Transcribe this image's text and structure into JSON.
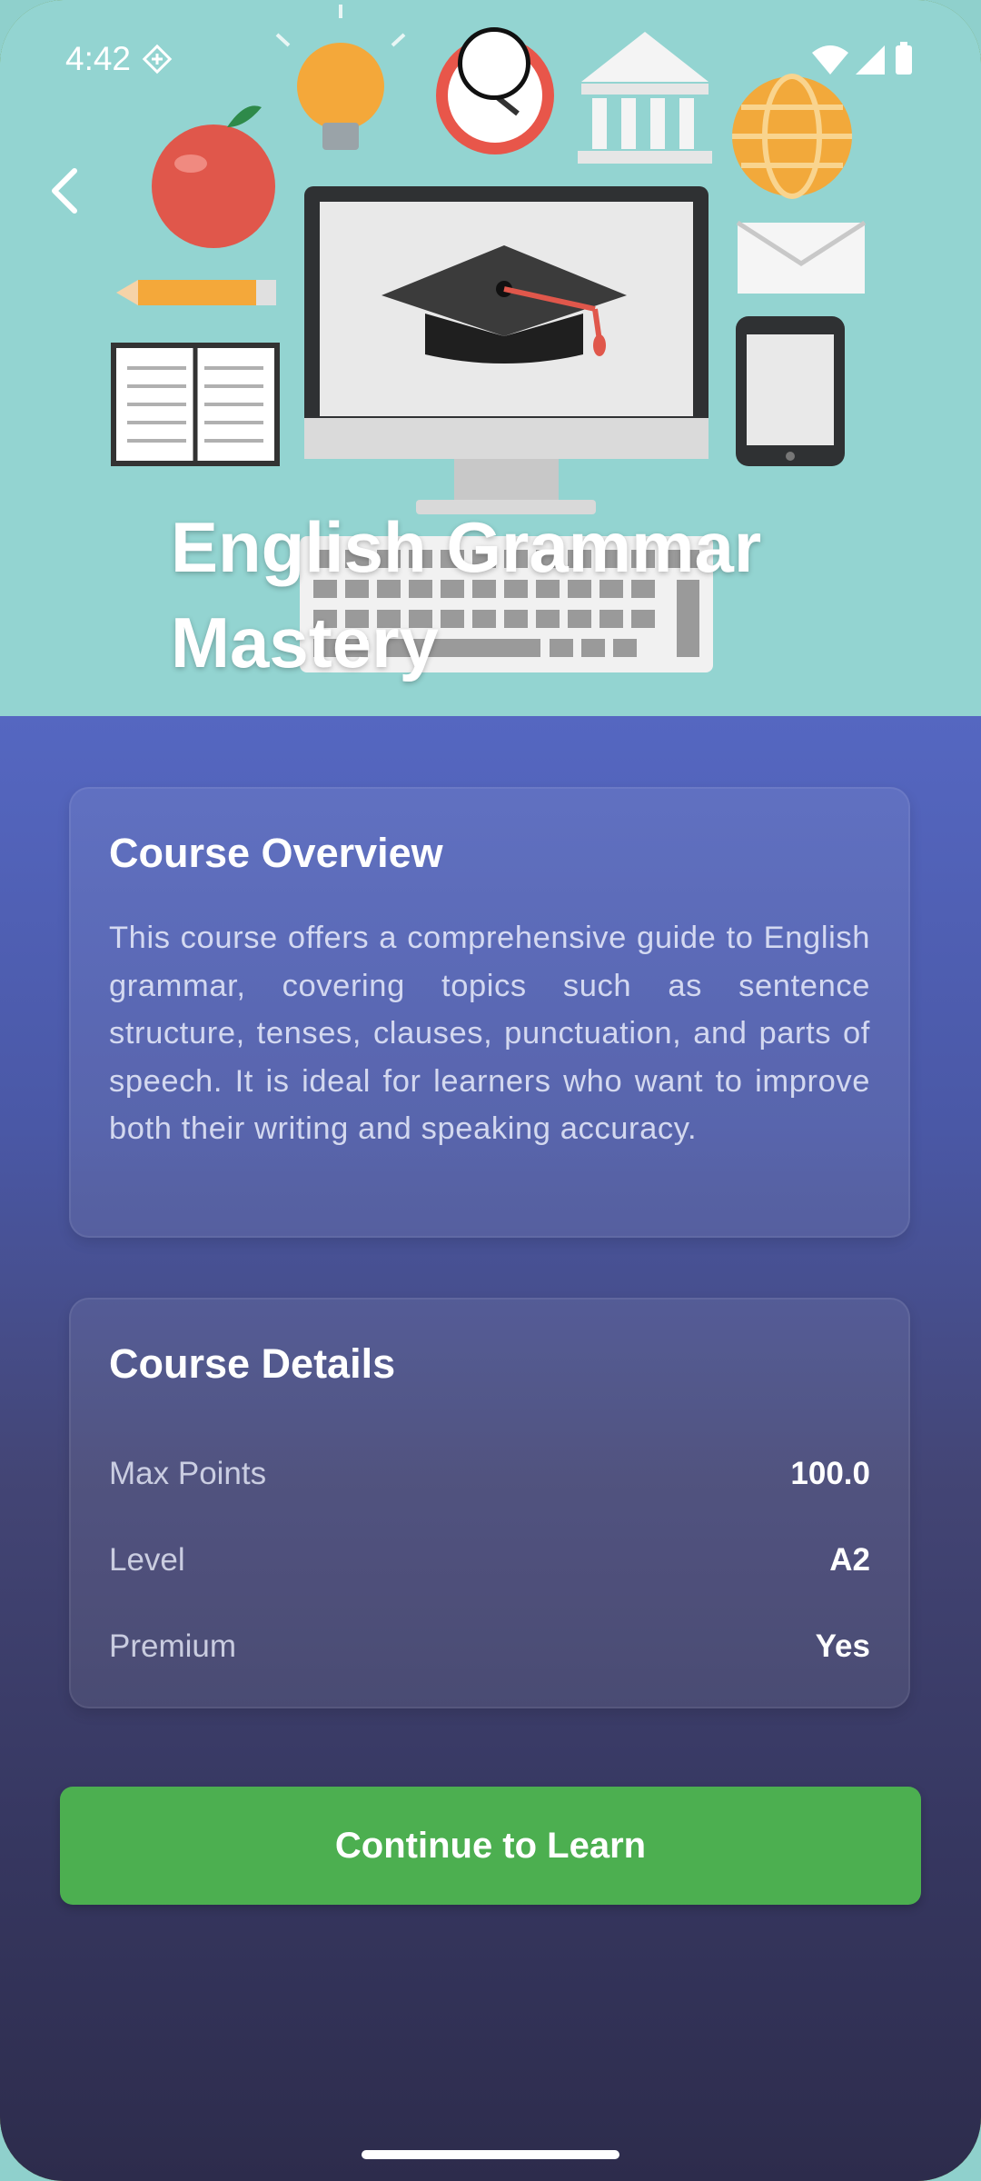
{
  "status_bar": {
    "time": "4:42"
  },
  "hero": {
    "title": "English Grammar Mastery"
  },
  "overview": {
    "title": "Course Overview",
    "text": "This course offers a comprehensive guide to English grammar, covering topics such as sentence structure, tenses, clauses, punctuation, and parts of speech. It is ideal for learners who want to improve both their writing and speaking accuracy."
  },
  "details": {
    "title": "Course Details",
    "rows": [
      {
        "label": "Max Points",
        "value": "100.0"
      },
      {
        "label": "Level",
        "value": "A2"
      },
      {
        "label": "Premium",
        "value": "Yes"
      }
    ]
  },
  "cta": {
    "label": "Continue to Learn"
  },
  "colors": {
    "hero_bg": "#93d4d1",
    "gradient_top": "#5567c1",
    "gradient_bottom": "#2d2c4c",
    "cta_green": "#4caf50"
  }
}
